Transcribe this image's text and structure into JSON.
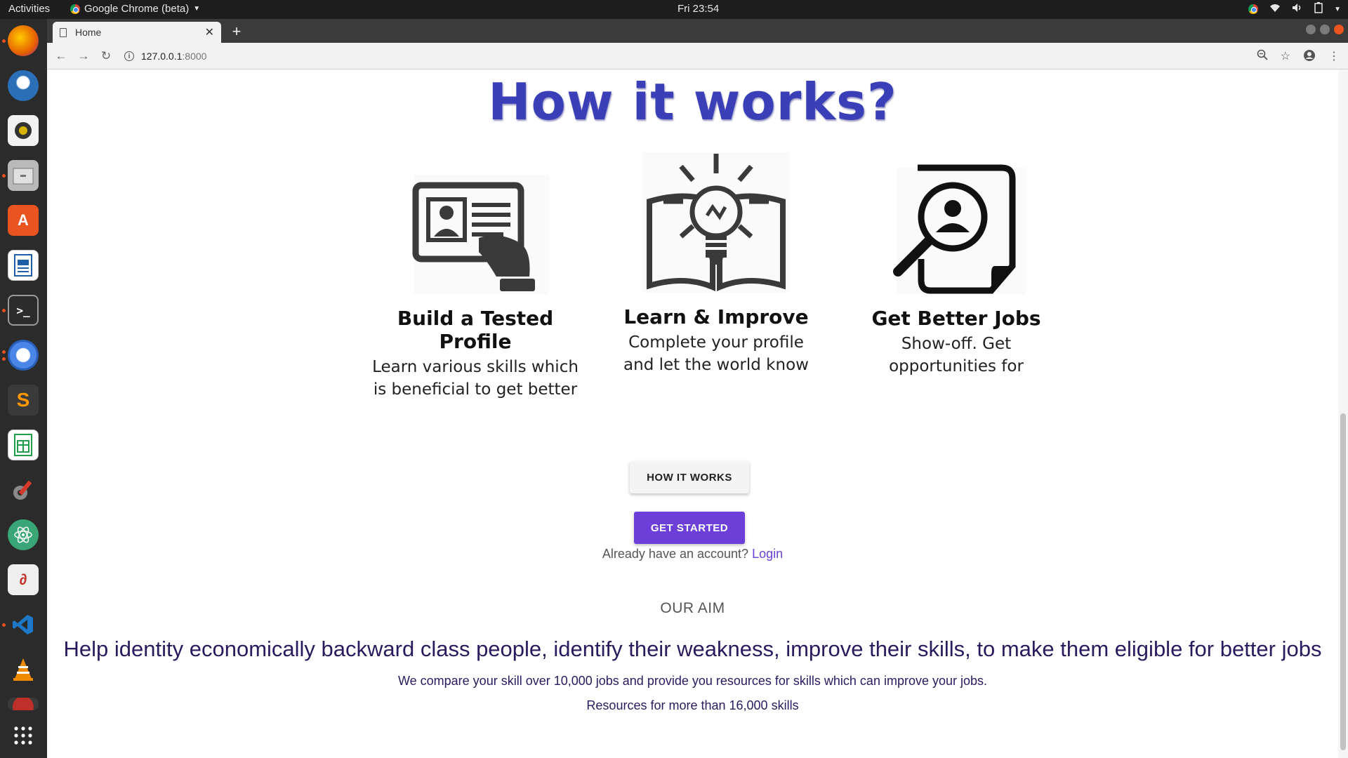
{
  "topbar": {
    "activities": "Activities",
    "app_name": "Google Chrome (beta)",
    "clock": "Fri 23:54"
  },
  "dock": {
    "apps": [
      {
        "name": "firefox-icon",
        "color": "#e66000"
      },
      {
        "name": "thunderbird-icon",
        "color": "#2a6fb8"
      },
      {
        "name": "rhythmbox-icon",
        "color": "#d8b400"
      },
      {
        "name": "files-icon",
        "color": "#8a8a8a"
      },
      {
        "name": "software-center-icon",
        "color": "#e95420"
      },
      {
        "name": "writer-icon",
        "color": "#1f5fa8"
      },
      {
        "name": "terminal-icon",
        "color": "#2c2c2c"
      },
      {
        "name": "chromium-icon",
        "color": "#4a86e8"
      },
      {
        "name": "sublime-text-icon",
        "color": "#3a3a3a"
      },
      {
        "name": "calc-icon",
        "color": "#1e9e4a"
      },
      {
        "name": "system-tools-icon",
        "color": "#6a6a6a"
      },
      {
        "name": "atom-icon",
        "color": "#3aa675"
      },
      {
        "name": "document-viewer-icon",
        "color": "#dddddd"
      },
      {
        "name": "vscode-icon",
        "color": "#1e78c8"
      },
      {
        "name": "vlc-icon",
        "color": "#f08a00"
      }
    ]
  },
  "browser": {
    "tab_title": "Home",
    "url_host": "127.0.0.1",
    "url_port": ":8000"
  },
  "page": {
    "title": "How it works?",
    "steps": [
      {
        "title": "Build a Tested Profile",
        "line1": "Learn various skills which",
        "line2": "is beneficial to get better"
      },
      {
        "title": "Learn & Improve",
        "line1": "Complete your profile",
        "line2": "and let the world know"
      },
      {
        "title": "Get Better Jobs",
        "line1": "Show-off. Get",
        "line2": "opportunities for"
      }
    ],
    "how_button": "HOW IT WORKS",
    "start_button": "GET STARTED",
    "login_prompt": "Already have an account?",
    "login_link": "Login",
    "aim_label": "OUR AIM",
    "aim_headline": "Help identity economically backward class people, identify their weakness, improve their skills, to make them eligible for better jobs",
    "aim_desc": "We compare your skill over 10,000 jobs and provide you resources for skills which can improve your jobs.",
    "aim_resources": "Resources for more than 16,000 skills"
  },
  "colors": {
    "accent": "#6c3fd8",
    "title_blue": "#3a3fb8",
    "aim_text": "#2a1a5e"
  }
}
